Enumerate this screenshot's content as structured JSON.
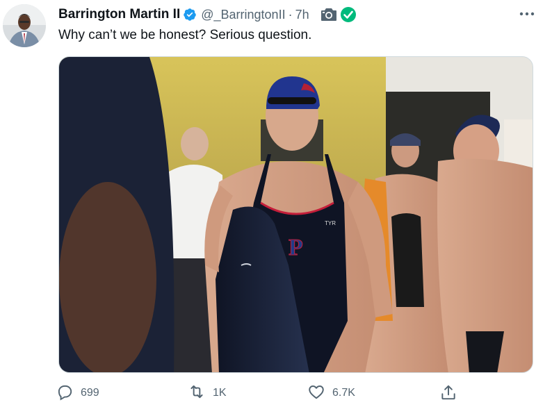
{
  "author": {
    "name": "Barrington Martin II",
    "handle": "@_BarringtonII",
    "separator": "·",
    "time": "7h"
  },
  "tweet": {
    "text": "Why can’t we be honest? Serious question."
  },
  "media": {
    "cap_letter": "P",
    "brand": "TYR"
  },
  "actions": {
    "reply_count": "699",
    "retweet_count": "1K",
    "like_count": "6.7K"
  },
  "colors": {
    "verified_blue": "#1d9bf0",
    "camera_gray": "#536471",
    "check_green": "#00ba7c",
    "secondary_text": "#536471"
  },
  "icons": [
    "verified-badge-icon",
    "camera-icon",
    "green-check-icon",
    "more-icon",
    "reply-icon",
    "retweet-icon",
    "like-icon",
    "share-icon"
  ]
}
